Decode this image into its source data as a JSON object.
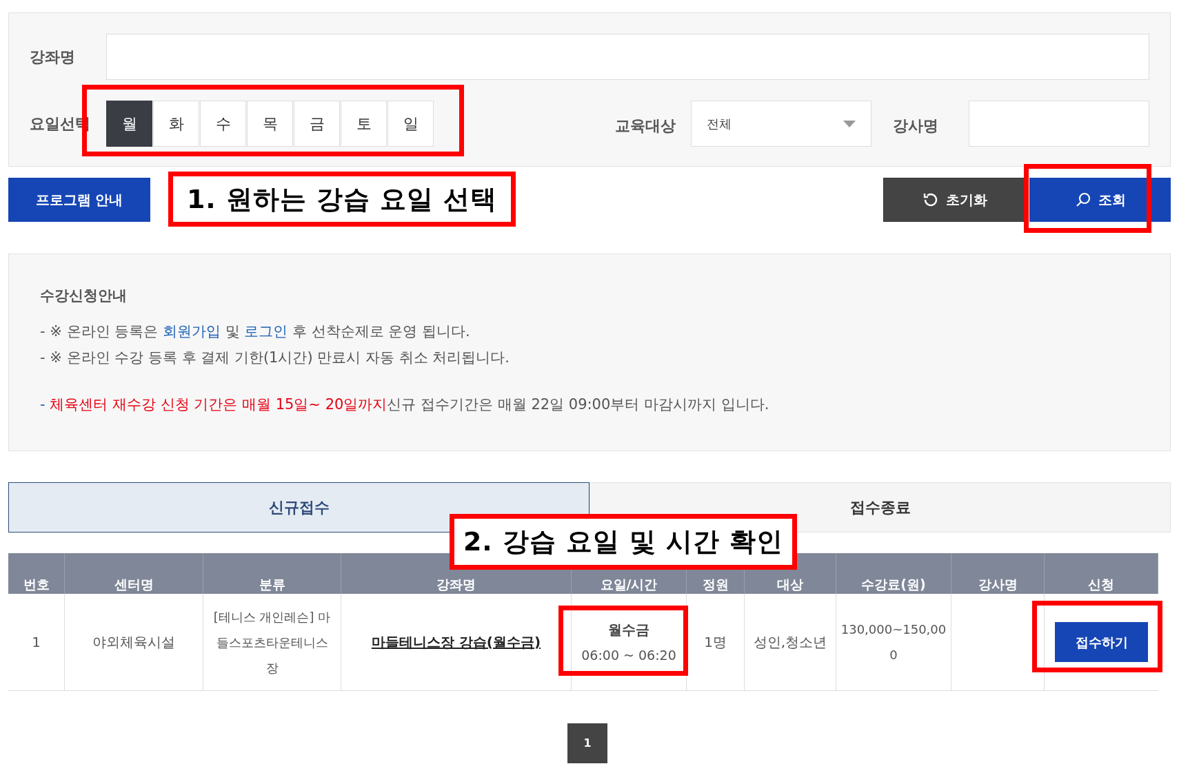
{
  "search": {
    "course_label": "강좌명",
    "day_label": "요일선택",
    "days": [
      {
        "label": "월",
        "selected": true
      },
      {
        "label": "화",
        "selected": false
      },
      {
        "label": "수",
        "selected": false
      },
      {
        "label": "목",
        "selected": false
      },
      {
        "label": "금",
        "selected": false
      },
      {
        "label": "토",
        "selected": false
      },
      {
        "label": "일",
        "selected": false
      }
    ],
    "target_label": "교육대상",
    "target_value": "전체",
    "instructor_label": "강사명"
  },
  "actions": {
    "program_guide": "프로그램 안내",
    "reset": "초기화",
    "search": "조회"
  },
  "notice": {
    "title": "수강신청안내",
    "lines": [
      [
        {
          "kind": "plain",
          "text": "- ※ 온라인 등록은 "
        },
        {
          "kind": "link",
          "text": "회원가입"
        },
        {
          "kind": "plain",
          "text": " 및 "
        },
        {
          "kind": "link",
          "text": "로그인"
        },
        {
          "kind": "plain",
          "text": " 후 선착순제로 운영 됩니다."
        }
      ],
      [
        {
          "kind": "plain",
          "text": "- ※ 온라인 수강 등록 후 결제 기한(1시간) 만료시 자동 취소 처리됩니다."
        }
      ],
      [
        {
          "kind": "dash",
          "text": "- "
        },
        {
          "kind": "alert",
          "text": "체육센터 재수강 신청 기간은 매월 15일~ 20일까지"
        },
        {
          "kind": "plain",
          "text": "신규 접수기간은 매월 22일 09:00부터 마감시까지 입니다."
        }
      ]
    ]
  },
  "tabs": [
    {
      "label": "신규접수",
      "selected": true
    },
    {
      "label": "접수종료",
      "selected": false
    }
  ],
  "table": {
    "columns": [
      "번호",
      "센터명",
      "분류",
      "강좌명",
      "요일/시간",
      "정원",
      "대상",
      "수강료(원)",
      "강사명",
      "신청"
    ],
    "rows": [
      {
        "number": "1",
        "center": "야외체육시설",
        "category": "[테니스 개인레슨] 마들스포츠타운테니스장",
        "course": "마들테니스장 강습(월수금)",
        "days": "월수금",
        "time": "06:00 ~ 06:20",
        "capacity": "1명",
        "target": "성인,청소년",
        "fee": "130,000~150,000",
        "instructor": "",
        "apply": "접수하기"
      }
    ]
  },
  "pagination": [
    {
      "label": "1",
      "selected": true
    }
  ],
  "annotations": [
    {
      "kind": "frame"
    },
    {
      "kind": "label",
      "text": "1. 원하는 강습 요일 선택"
    },
    {
      "kind": "frame"
    },
    {
      "kind": "label",
      "text": "2. 강습 요일 및 시간 확인"
    },
    {
      "kind": "frame"
    },
    {
      "kind": "frame"
    }
  ]
}
